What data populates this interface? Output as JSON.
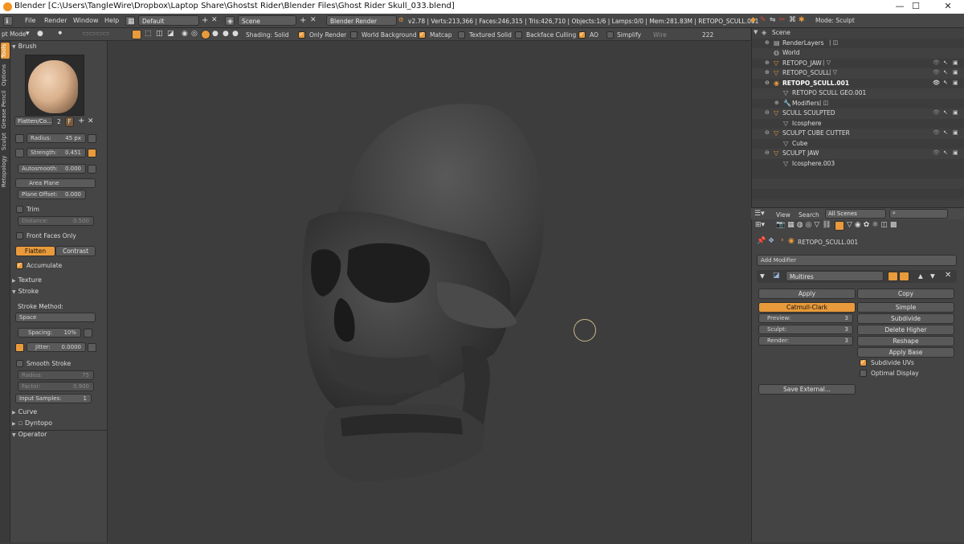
{
  "window": {
    "title": "Blender [C:\\Users\\TangleWire\\Dropbox\\Laptop Share\\Ghostst Rider\\Blender Files\\Ghost Rider Skull_033.blend]",
    "minimize": "—",
    "maximize": "☐",
    "close": "✕"
  },
  "info": {
    "menus": [
      "File",
      "Render",
      "Window",
      "Help"
    ],
    "screen_layout": "Default",
    "scene": "Scene",
    "render_engine": "Blender Render",
    "stats": "v2.78 | Verts:213,366 | Faces:246,315 | Tris:426,710 | Objects:1/6 | Lamps:0/0 | Mem:281.83M | RETOPO_SCULL.001",
    "mode_label": "Mode: Sculpt"
  },
  "viewport_header": {
    "mode": "pt Mode",
    "shading": "Shading: Solid",
    "only_render": "Only Render",
    "world_background": "World Background",
    "matcap": "Matcap",
    "textured_solid": "Textured Solid",
    "backface_culling": "Backface Culling",
    "ao": "AO",
    "simplify": "Simplify",
    "wire": "Wire",
    "count": "222",
    "only_render_on": true,
    "world_background_on": false,
    "matcap_on": true,
    "textured_solid_on": false,
    "backface_culling_on": false,
    "ao_on": true,
    "simplify_on": false
  },
  "tabs": [
    "Tools",
    "Options",
    "Grease Pencil",
    "Sculpt",
    "Retopology"
  ],
  "tools": {
    "brush_header": "Brush",
    "brush_name": "Flatten/Co...",
    "brush_users": "2",
    "brush_fake": "F",
    "radius_label": "Radius:",
    "radius_value": "45 px",
    "strength_label": "Strength:",
    "strength_value": "0.451",
    "autosmooth_label": "Autosmooth:",
    "autosmooth_value": "0.000",
    "area_plane": "Area Plane",
    "plane_offset_label": "Plane Offset:",
    "plane_offset_value": "0.000",
    "trim": "Trim",
    "distance_label": "Distance:",
    "distance_value": "0.500",
    "front_faces_only": "Front Faces Only",
    "flatten": "Flatten",
    "contrast": "Contrast",
    "accumulate": "Accumulate",
    "texture": "Texture",
    "stroke": "Stroke",
    "stroke_method": "Stroke Method:",
    "stroke_method_value": "Space",
    "spacing_label": "Spacing:",
    "spacing_value": "10%",
    "jitter_label": "Jitter:",
    "jitter_value": "0.0000",
    "smooth_stroke": "Smooth Stroke",
    "ss_radius_label": "Radius:",
    "ss_radius_value": "75",
    "ss_factor_label": "Factor:",
    "ss_factor_value": "0.900",
    "input_samples_label": "Input Samples:",
    "input_samples_value": "1",
    "curve": "Curve",
    "dyntopo": "Dyntopo",
    "operator": "Operator"
  },
  "outliner": {
    "rows": [
      {
        "label": "Scene"
      },
      {
        "label": "RenderLayers"
      },
      {
        "label": "World"
      },
      {
        "label": "RETOPO_JAW"
      },
      {
        "label": "RETOPO_SCULL"
      },
      {
        "label": "RETOPO_SCULL.001"
      },
      {
        "label": "RETOPO SCULL GEO.001"
      },
      {
        "label": "Modifiers"
      },
      {
        "label": "SCULL SCULPTED"
      },
      {
        "label": "Icosphere"
      },
      {
        "label": "SCULPT CUBE CUTTER"
      },
      {
        "label": "Cube"
      },
      {
        "label": "SCULPT JAW"
      },
      {
        "label": "Icosphere.003"
      }
    ]
  },
  "props_header": {
    "view": "View",
    "search": "Search",
    "filter": "All Scenes"
  },
  "properties": {
    "object_name": "RETOPO_SCULL.001",
    "add_modifier": "Add Modifier",
    "modifier_name": "Multires",
    "apply": "Apply",
    "copy": "Copy",
    "catmull_clark": "Catmull-Clark",
    "simple": "Simple",
    "preview_label": "Preview:",
    "preview_value": "3",
    "sculpt_label": "Sculpt:",
    "sculpt_value": "3",
    "render_label": "Render:",
    "render_value": "3",
    "subdivide": "Subdivide",
    "delete_higher": "Delete Higher",
    "reshape": "Reshape",
    "apply_base": "Apply Base",
    "subdivide_uvs": "Subdivide UVs",
    "optimal_display": "Optimal Display",
    "save_external": "Save External..."
  }
}
